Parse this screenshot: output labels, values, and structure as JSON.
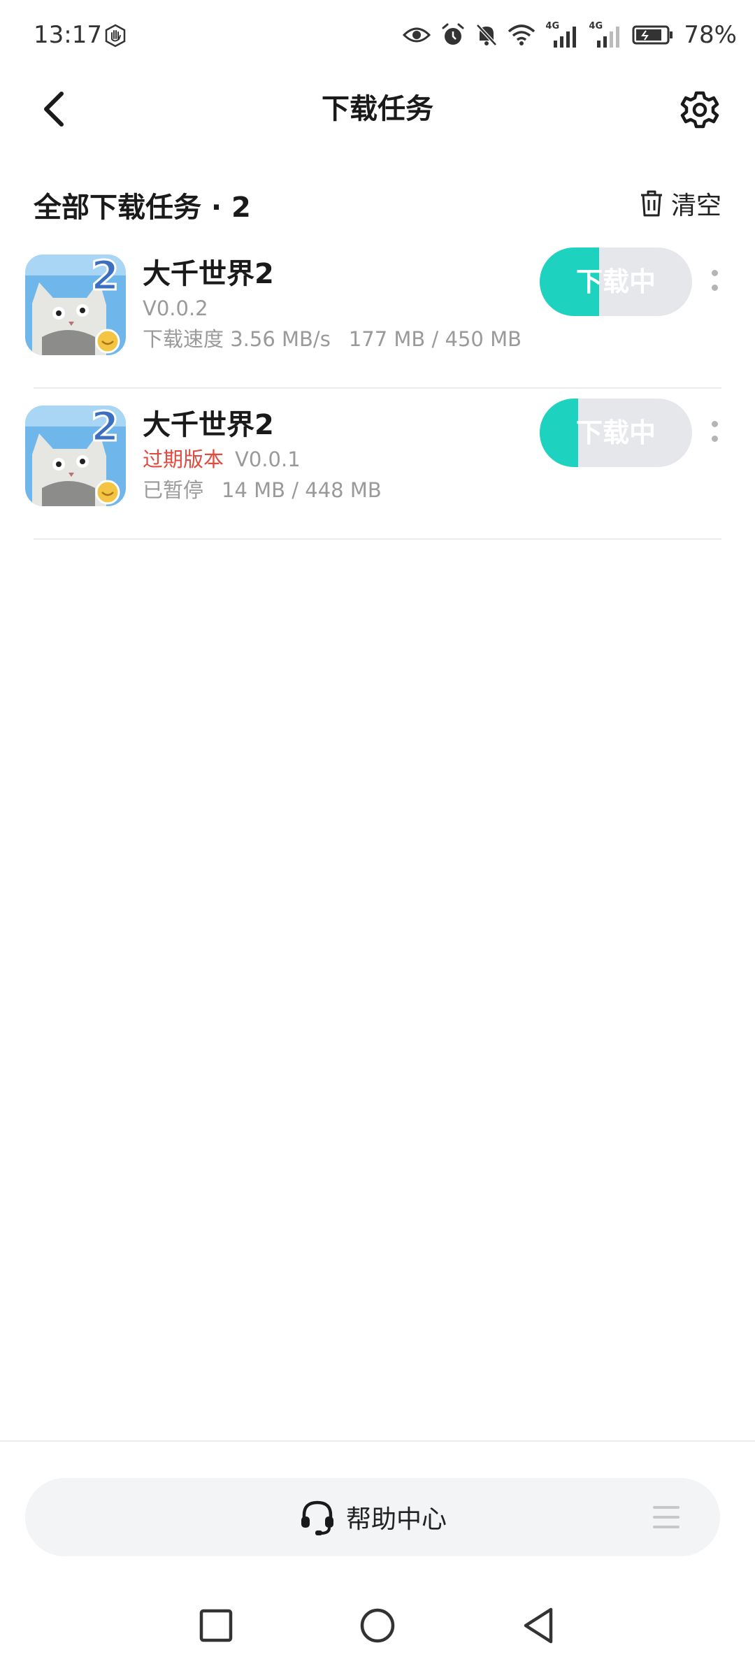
{
  "status_bar": {
    "time": "13:17",
    "network_1": "4G",
    "network_2": "4G",
    "battery": "78%"
  },
  "header": {
    "title": "下载任务"
  },
  "section": {
    "title": "全部下载任务 · 2",
    "clear_label": "清空"
  },
  "tasks": [
    {
      "name": "大千世界2",
      "expired_label": "",
      "version": "V0.0.2",
      "status": "下载速度 3.56 MB/s",
      "size": "177 MB / 450 MB",
      "button_label": "下载中",
      "progress": 0.39
    },
    {
      "name": "大千世界2",
      "expired_label": "过期版本",
      "version": "V0.0.1",
      "status": "已暂停",
      "size": "14 MB / 448 MB",
      "button_label": "下载中",
      "progress": 0.25
    }
  ],
  "help": {
    "label": "帮助中心"
  },
  "colors": {
    "accent": "#1dd3bf",
    "expired": "#e04a3f",
    "button_track": "#e5e7ea"
  },
  "icons": [
    "hand-icon",
    "eye-icon",
    "alarm-icon",
    "mute-icon",
    "wifi-icon",
    "signal-icon",
    "battery-icon",
    "back-icon",
    "gear-icon",
    "trash-icon",
    "more-icon",
    "headset-icon",
    "menu-icon",
    "square-nav-icon",
    "circle-nav-icon",
    "triangle-nav-icon"
  ]
}
